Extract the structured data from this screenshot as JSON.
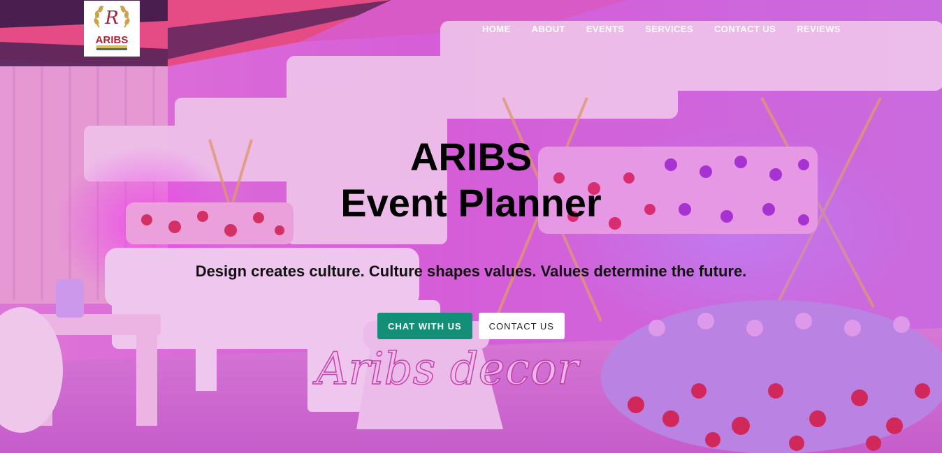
{
  "brand": {
    "logo_letter": "R",
    "logo_text": "ARIBS",
    "watermark": "Aribs decor"
  },
  "nav": {
    "items": [
      "HOME",
      "ABOUT",
      "EVENTS",
      "SERVICES",
      "CONTACT US",
      "REVIEWS"
    ]
  },
  "hero": {
    "title_line1": "ARIBS",
    "title_line2": "Event Planner",
    "subtitle": "Design creates culture. Culture shapes values. Values determine the future.",
    "chat_button": "CHAT WITH US",
    "contact_button": "CONTACT US"
  },
  "colors": {
    "overlay": "#d656d6",
    "chat_button": "#138f78",
    "nav_text": "#ffffff"
  }
}
